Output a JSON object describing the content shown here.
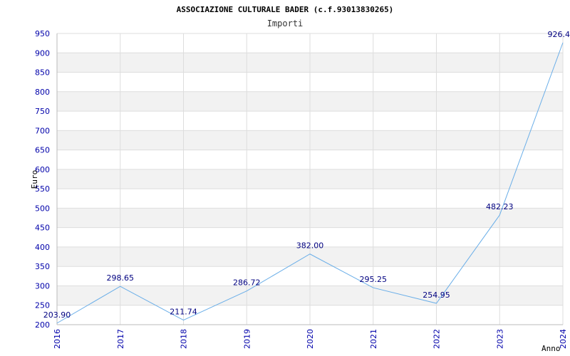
{
  "chart_data": {
    "type": "line",
    "title": "ASSOCIAZIONE CULTURALE BADER (c.f.93013830265)",
    "subtitle": "Importi",
    "xlabel": "Anno",
    "ylabel": "Euro",
    "categories": [
      "2016",
      "2017",
      "2018",
      "2019",
      "2020",
      "2021",
      "2022",
      "2023",
      "2024"
    ],
    "values": [
      203.9,
      298.65,
      211.74,
      286.72,
      382.0,
      295.25,
      254.95,
      482.23,
      926.4
    ],
    "value_labels": [
      "203.90",
      "298.65",
      "211.74",
      "286.72",
      "382.00",
      "295.25",
      "254.95",
      "482.23",
      "926.4"
    ],
    "ylim": [
      200,
      950
    ],
    "yticks": [
      200,
      250,
      300,
      350,
      400,
      450,
      500,
      550,
      600,
      650,
      700,
      750,
      800,
      850,
      900,
      950
    ],
    "grid": true,
    "colors": {
      "line": "#6aaee8",
      "band": "#f2f2f2",
      "grid": "#dddddd",
      "ticks": "#0000aa"
    }
  }
}
